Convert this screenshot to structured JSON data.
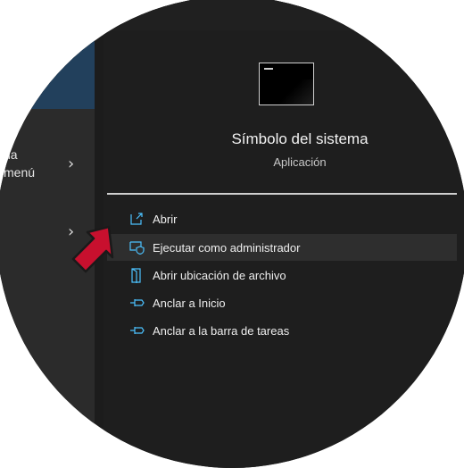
{
  "start_menu": {
    "items": [
      {
        "label_line1": "na",
        "label_line2": "menú"
      },
      {
        "label_line1": "",
        "label_line2": ""
      }
    ]
  },
  "app": {
    "title": "Símbolo del sistema",
    "type": "Aplicación",
    "icon": "command-prompt-icon"
  },
  "context_menu": {
    "items": [
      {
        "label": "Abrir",
        "icon": "open-icon"
      },
      {
        "label": "Ejecutar como administrador",
        "icon": "shield-admin-icon"
      },
      {
        "label": "Abrir ubicación de archivo",
        "icon": "file-location-icon"
      },
      {
        "label": "Anclar a Inicio",
        "icon": "pin-icon"
      },
      {
        "label": "Anclar a la barra de tareas",
        "icon": "pin-icon"
      }
    ]
  },
  "colors": {
    "accent": "#4cc2ff",
    "pointer_arrow": "#c8102e"
  }
}
